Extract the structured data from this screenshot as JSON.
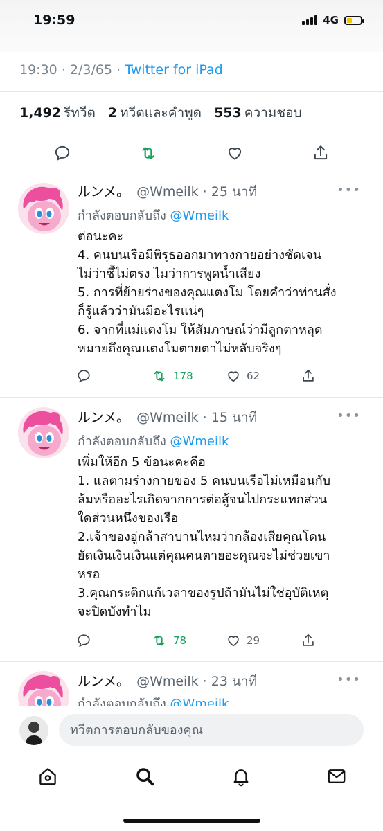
{
  "status_bar": {
    "time": "19:59",
    "network": "4G"
  },
  "tweet_meta": {
    "time": "19:30",
    "sep": "·",
    "date": "2/3/65",
    "source": "Twitter for iPad"
  },
  "stats": {
    "retweets_count": "1,492",
    "retweets_label": "รีทวีต",
    "quotes_count": "2",
    "quotes_label": "ทวีตและคำพูด",
    "likes_count": "553",
    "likes_label": "ความชอบ"
  },
  "replies": [
    {
      "name": "ルンメ。",
      "handle": "@Wmeilk · 25 นาที",
      "reply_prefix": "กำลังตอบกลับถึง",
      "reply_to": "@Wmeilk",
      "lines": [
        "ต่อนะคะ",
        " 4. คนบนเรือมีพิรุธออกมาทางกายอย่างชัดเจน",
        "ไม่ว่าชี้ไม่ตรง ไมว่าการพูดน้ำเสียง",
        "5. การที่ย้ายร่างของคุณแตงโม โดยคำว่าท่านสั่ง",
        "ก็รู้แล้วว่ามันมีอะไรแน่ๆ",
        "6. จากที่แม่แตงโม ให้สัมภาษณ์ว่ามีลูกตาหลุด",
        "หมายถึงคุณแตงโมตายตาไม่หลับจริงๆ"
      ],
      "retweets": "178",
      "likes": "62"
    },
    {
      "name": "ルンメ。",
      "handle": "@Wmeilk · 15 นาที",
      "reply_prefix": "กำลังตอบกลับถึง",
      "reply_to": "@Wmeilk",
      "lines": [
        "เพิ่มให้อีก 5 ข้อนะคะคือ",
        "1. แลตามร่างกายของ 5 คนบนเรือไม่เหมือนกับ",
        "ล้มหรืออะไรเกิดจากการต่อสู้จนไปกระแทกส่วน",
        "ใดส่วนหนึ่งของเรือ",
        "2.เจ้าของอู่กล้าสาบานไหมว่ากล้องเสียคุณโดน",
        "ยัดเงินเงินเงินแต่คุณคนตายอะคุณจะไม่ช่วยเขา",
        "หรอ",
        "3.คุณกระติกแก้เวลาของรูปถ้ามันไม่ใช่อุบัติเหตุ",
        "จะปิดบังทำไม"
      ],
      "retweets": "78",
      "likes": "29"
    },
    {
      "name": "ルンメ。",
      "handle": "@Wmeilk · 23 นาที",
      "reply_prefix": "กำลังตอบกลับถึง",
      "reply_to": "@Wmeilk"
    }
  ],
  "composer": {
    "placeholder": "ทวีตการตอบกลับของคุณ"
  },
  "tabbar": [
    "home-icon",
    "search-icon",
    "notifications-icon",
    "messages-icon"
  ],
  "colors": {
    "accent": "#1d9bf0",
    "retweet": "#17a05d",
    "muted": "#5b6570"
  }
}
